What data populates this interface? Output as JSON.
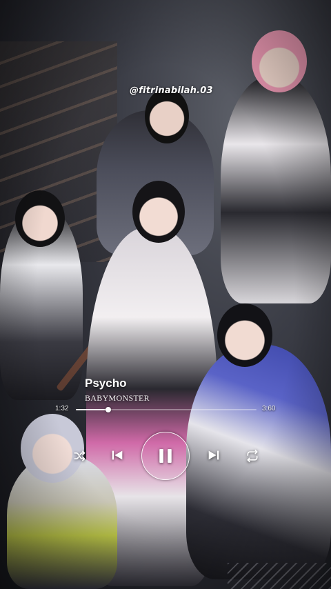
{
  "watermark": {
    "text": "@fitrinabilah.03"
  },
  "player": {
    "song_title": "Psycho",
    "artist": "BABYMONSTER",
    "time_elapsed": "1:32",
    "time_total": "3:60",
    "progress_fraction": 0.18,
    "state": "playing",
    "controls": {
      "shuffle_icon": "shuffle-icon",
      "previous_icon": "skip-previous-icon",
      "playpause_icon": "pause-icon",
      "next_icon": "skip-next-icon",
      "repeat_icon": "repeat-icon"
    }
  },
  "colors": {
    "text": "#ffffff",
    "track": "#ffffff"
  }
}
